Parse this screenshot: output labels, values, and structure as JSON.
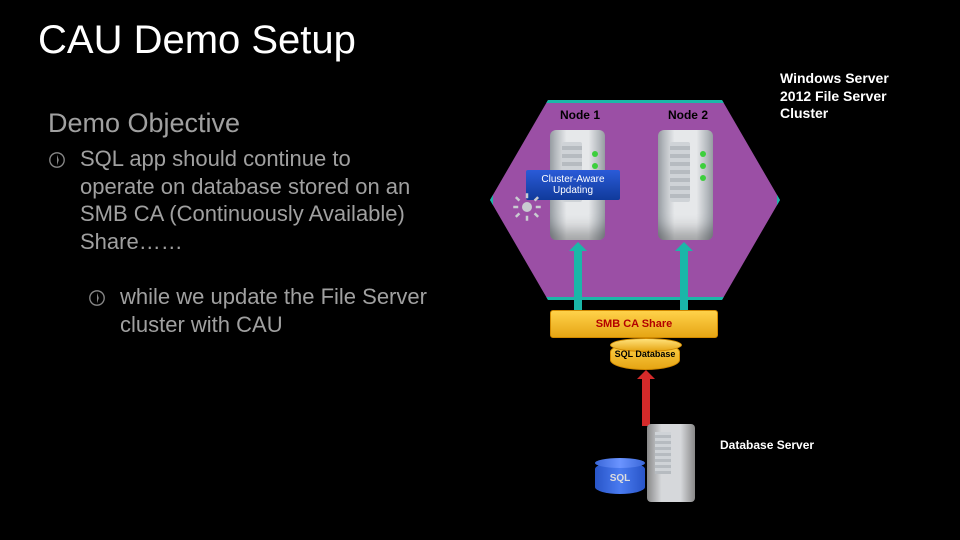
{
  "title": "CAU Demo Setup",
  "subtitle": "Demo Objective",
  "bullets": [
    "SQL app should continue to operate on database stored on an SMB CA (Continuously Available) Share……",
    "while we update the File Server cluster with CAU"
  ],
  "diagram": {
    "cluster_label": "Windows Server 2012 File Server Cluster",
    "node1": "Node 1",
    "node2": "Node 2",
    "cau_badge": "Cluster-Aware Updating",
    "smb_share": "SMB CA Share",
    "sql_db": "SQL Database",
    "db_server_label": "Database Server",
    "sql_badge": "SQL"
  }
}
